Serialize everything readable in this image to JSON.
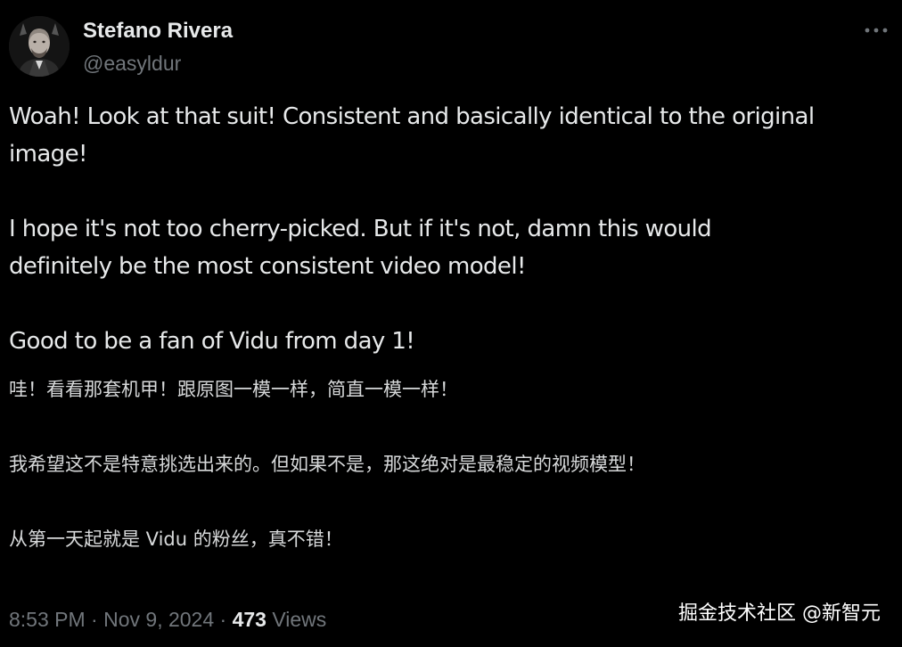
{
  "author": {
    "display_name": "Stefano Rivera",
    "handle": "@easyldur"
  },
  "tweet": {
    "en_line_1": "Woah! Look at that suit! Consistent and basically identical to the original",
    "en_line_2": "image!",
    "en_line_3": "I hope it's not too cherry-picked. But if it's not, damn this would",
    "en_line_4": "definitely be the most consistent video model!",
    "en_line_5": "Good to be a fan of Vidu from day 1!",
    "zh_line_1": "哇！看看那套机甲！跟原图一模一样，简直一模一样！",
    "zh_line_2": "我希望这不是特意挑选出来的。但如果不是，那这绝对是最稳定的视频模型！",
    "zh_line_3": "从第一天起就是 Vidu 的粉丝，真不错！"
  },
  "meta": {
    "time": "8:53 PM",
    "separator_1": "·",
    "date": "Nov 9, 2024",
    "separator_2": "·",
    "views_count": "473",
    "views_label": "Views"
  },
  "watermark": {
    "text": "掘金技术社区 @新智元"
  },
  "icons": {
    "more": "more-horizontal-icon"
  },
  "colors": {
    "background": "#000000",
    "primary_text": "#e7e9ea",
    "secondary_text": "#71767b"
  }
}
